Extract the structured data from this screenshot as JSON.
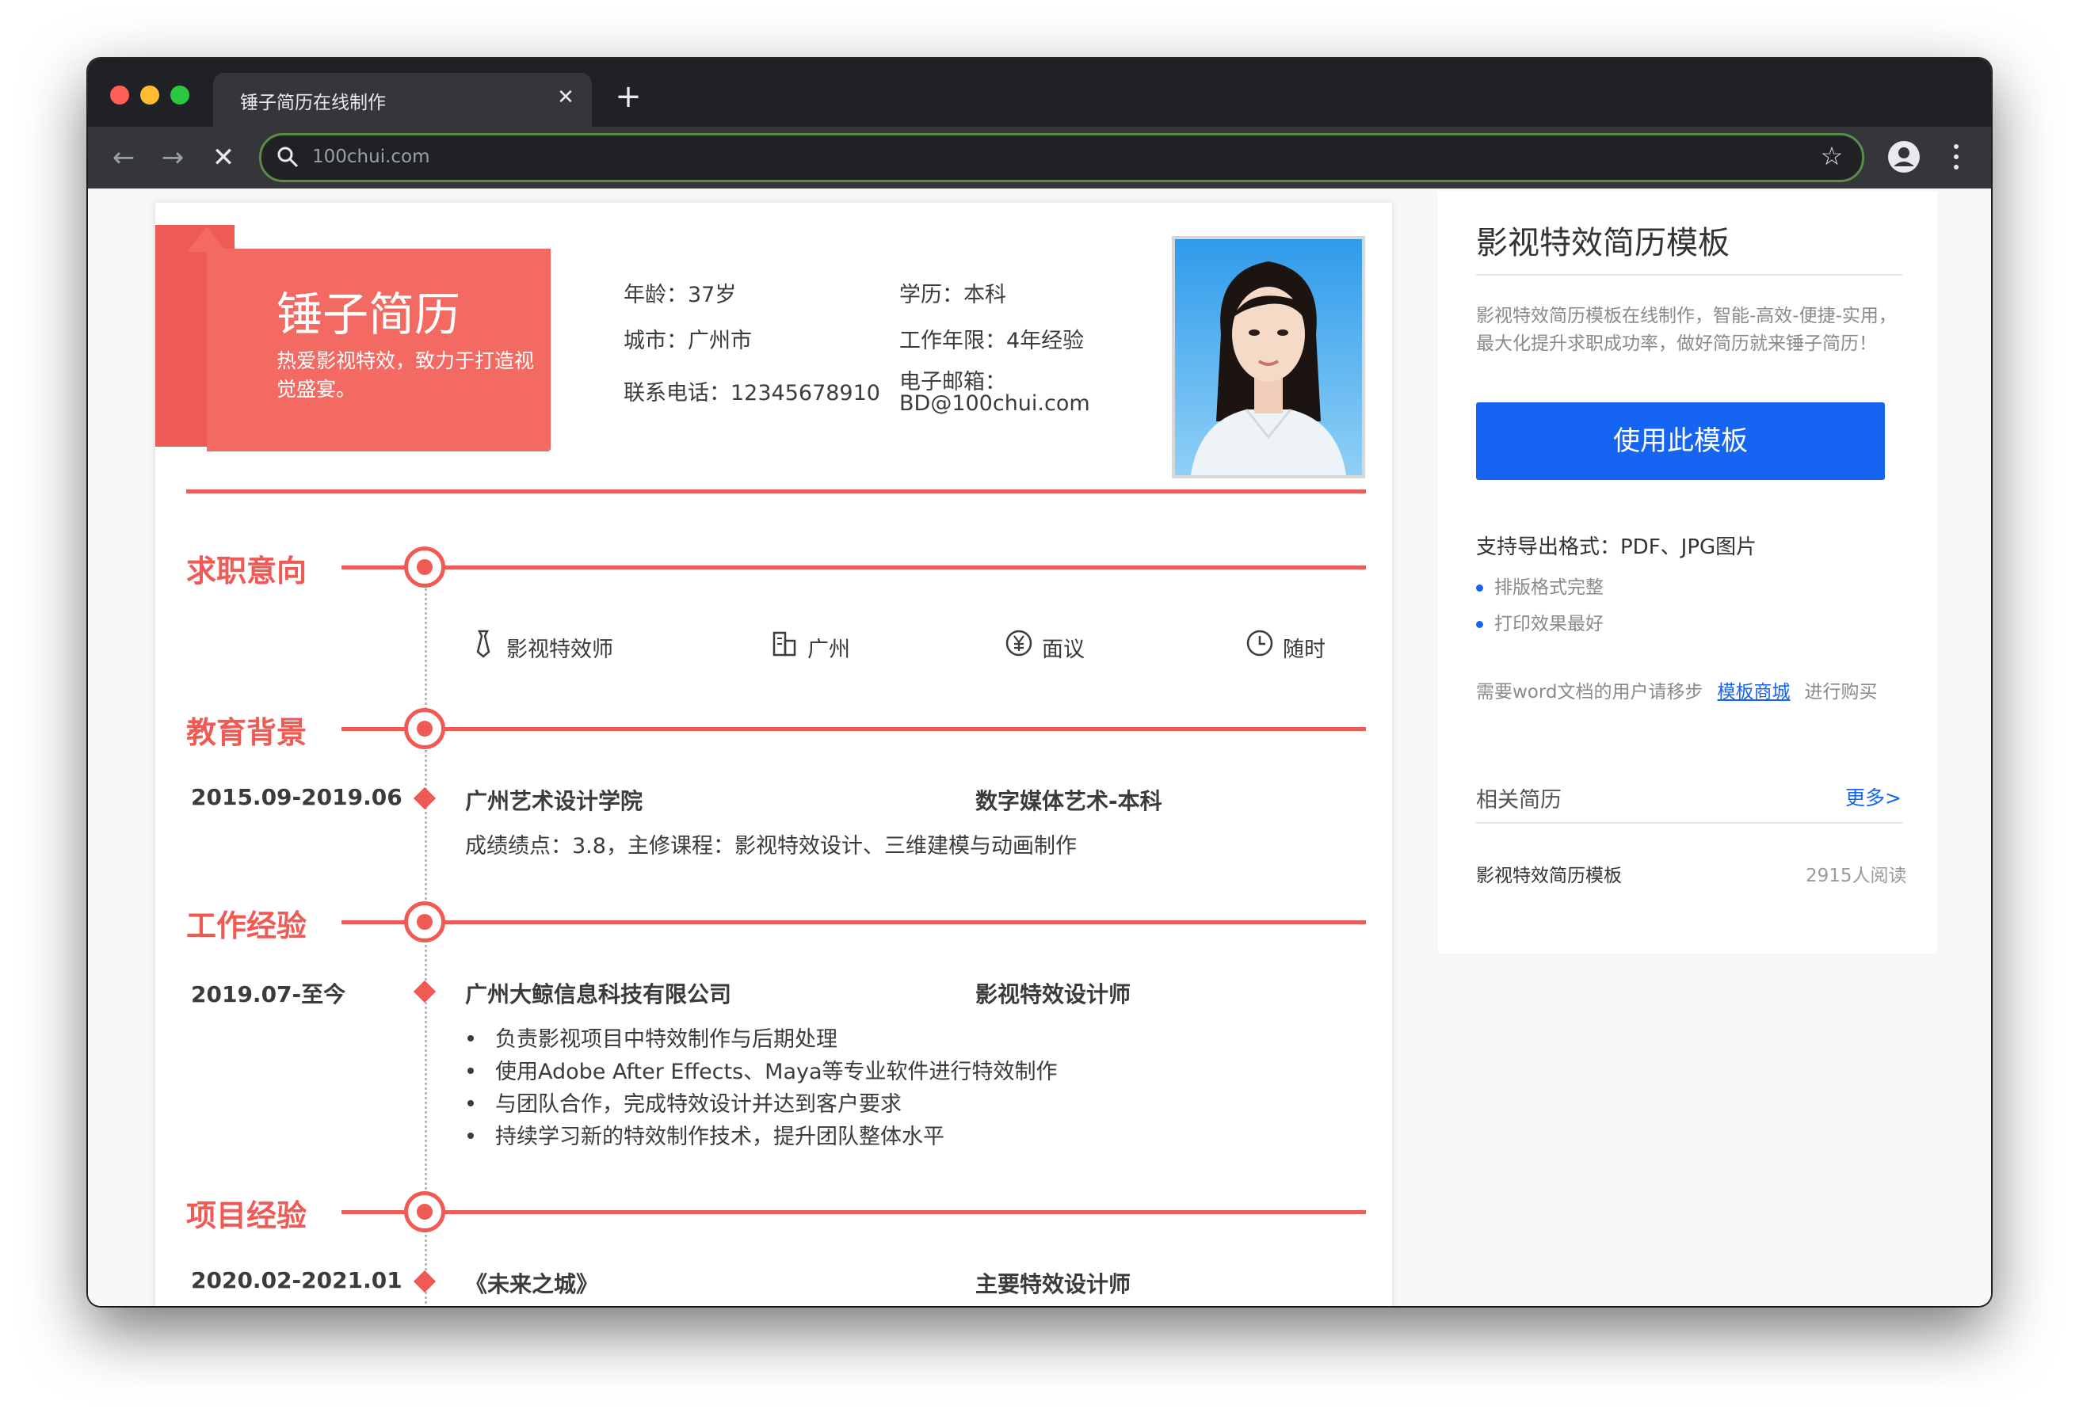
{
  "browser": {
    "tab_title": "锤子简历在线制作",
    "tab_close": "✕",
    "new_tab": "+",
    "url": "100chui.com"
  },
  "resume": {
    "name": "锤子简历",
    "motto": "热爱影视特效，致力于打造视觉盛宴。",
    "info": {
      "age": "年龄：37岁",
      "education": "学历：本科",
      "city": "城市：广州市",
      "years": "工作年限：4年经验",
      "phone": "联系电话：12345678910",
      "email_label": "电子邮箱：",
      "email": "BD@100chui.com"
    },
    "sections": {
      "intent": "求职意向",
      "education": "教育背景",
      "work": "工作经验",
      "project": "项目经验"
    },
    "intent": {
      "position": "影视特效师",
      "city": "广州",
      "salary": "面议",
      "availability": "随时"
    },
    "education": {
      "date": "2015.09-2019.06",
      "school": "广州艺术设计学院",
      "major": "数字媒体艺术-本科",
      "detail": "成绩绩点：3.8，主修课程：影视特效设计、三维建模与动画制作"
    },
    "work": {
      "date": "2019.07-至今",
      "company": "广州大鲸信息科技有限公司",
      "role": "影视特效设计师",
      "bullets": [
        "负责影视项目中特效制作与后期处理",
        "使用Adobe After Effects、Maya等专业软件进行特效制作",
        "与团队合作，完成特效设计并达到客户要求",
        "持续学习新的特效制作技术，提升团队整体水平"
      ]
    },
    "project": {
      "date": "2020.02-2021.01",
      "name": "《未来之城》",
      "role": "主要特效设计师"
    }
  },
  "sidebar": {
    "title": "影视特效简历模板",
    "desc": "影视特效简历模板在线制作，智能-高效-便捷-实用，最大化提升求职成功率，做好简历就来锤子简历！",
    "button": "使用此模板",
    "formats": "支持导出格式：PDF、JPG图片",
    "bullets": [
      "排版格式完整",
      "打印效果最好"
    ],
    "note_before": "需要word文档的用户请移步",
    "note_link": "模板商城",
    "note_after": "进行购买",
    "related": "相关简历",
    "more": "更多>",
    "item_title": "影视特效简历模板",
    "item_reads": "2915人阅读"
  },
  "colors": {
    "accent_red": "#ef5a54",
    "primary_blue": "#1565f2",
    "chrome_dark": "#202124"
  }
}
